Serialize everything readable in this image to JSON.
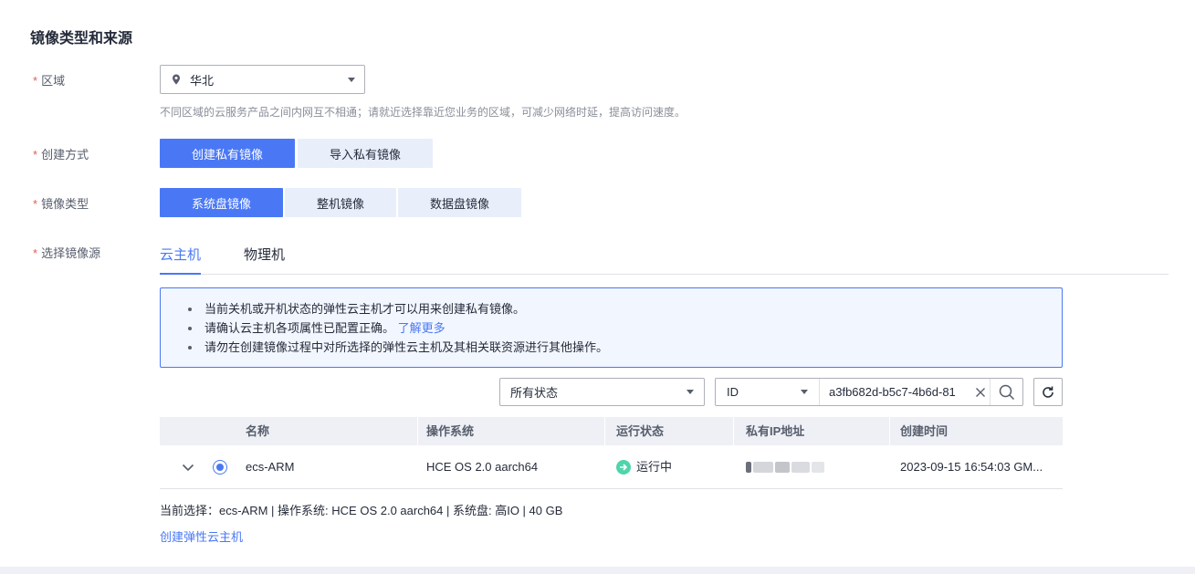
{
  "section_title": "镜像类型和来源",
  "region": {
    "label": "区域",
    "value": "华北",
    "hint": "不同区域的云服务产品之间内网互不相通；请就近选择靠近您业务的区域，可减少网络时延，提高访问速度。"
  },
  "create_method": {
    "label": "创建方式",
    "options": [
      "创建私有镜像",
      "导入私有镜像"
    ]
  },
  "image_type": {
    "label": "镜像类型",
    "options": [
      "系统盘镜像",
      "整机镜像",
      "数据盘镜像"
    ]
  },
  "image_source": {
    "label": "选择镜像源",
    "tabs": [
      "云主机",
      "物理机"
    ]
  },
  "notice": {
    "items": [
      "当前关机或开机状态的弹性云主机才可以用来创建私有镜像。",
      "请确认云主机各项属性已配置正确。",
      "请勿在创建镜像过程中对所选择的弹性云主机及其相关联资源进行其他操作。"
    ],
    "learn_more": "了解更多"
  },
  "filters": {
    "status": "所有状态",
    "field": "ID",
    "search_value": "a3fb682d-b5c7-4b6d-81"
  },
  "table": {
    "headers": [
      "名称",
      "操作系统",
      "运行状态",
      "私有IP地址",
      "创建时间"
    ],
    "rows": [
      {
        "name": "ecs-ARM",
        "os": "HCE OS 2.0 aarch64",
        "status": "运行中",
        "created": "2023-09-15 16:54:03 GM..."
      }
    ]
  },
  "summary": "当前选择：ecs-ARM | 操作系统: HCE OS 2.0 aarch64 | 系统盘: 高IO | 40 GB",
  "create_link": "创建弹性云主机",
  "colors": {
    "primary": "#4a78f5",
    "required": "#e05f55",
    "running": "#50d4ab"
  }
}
